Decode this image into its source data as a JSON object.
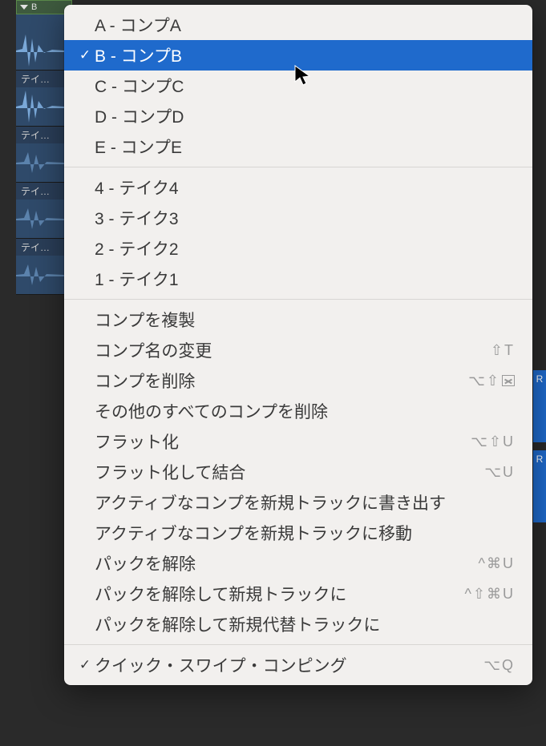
{
  "tracks": {
    "header_label": "B",
    "lanes": [
      {
        "label": ""
      },
      {
        "label": "テイ…"
      },
      {
        "label": "テイ…"
      },
      {
        "label": "テイ…"
      },
      {
        "label": "テイ…"
      }
    ]
  },
  "region_hint_letter": "R",
  "menu": {
    "comps": [
      {
        "key": "A",
        "label": "A - コンプA",
        "checked": false,
        "selected": false
      },
      {
        "key": "B",
        "label": "B - コンプB",
        "checked": true,
        "selected": true
      },
      {
        "key": "C",
        "label": "C - コンプC",
        "checked": false,
        "selected": false
      },
      {
        "key": "D",
        "label": "D - コンプD",
        "checked": false,
        "selected": false
      },
      {
        "key": "E",
        "label": "E - コンプE",
        "checked": false,
        "selected": false
      }
    ],
    "takes": [
      {
        "label": "4 - テイク4"
      },
      {
        "label": "3 - テイク3"
      },
      {
        "label": "2 - テイク2"
      },
      {
        "label": "1 - テイク1"
      }
    ],
    "actions": [
      {
        "id": "duplicate-comp",
        "label": "コンプを複製",
        "shortcut": ""
      },
      {
        "id": "rename-comp",
        "label": "コンプ名の変更",
        "shortcut": "⇧T"
      },
      {
        "id": "delete-comp",
        "label": "コンプを削除",
        "shortcut": "⌥⇧",
        "shortcut_has_delbox": true
      },
      {
        "id": "delete-other-comps",
        "label": "その他のすべてのコンプを削除",
        "shortcut": ""
      },
      {
        "id": "flatten",
        "label": "フラット化",
        "shortcut": "⌥⇧U"
      },
      {
        "id": "flatten-merge",
        "label": "フラット化して結合",
        "shortcut": "⌥U"
      },
      {
        "id": "export-active-track",
        "label": "アクティブなコンプを新規トラックに書き出す",
        "shortcut": ""
      },
      {
        "id": "move-active-track",
        "label": "アクティブなコンプを新規トラックに移動",
        "shortcut": ""
      },
      {
        "id": "unpack",
        "label": "パックを解除",
        "shortcut": "^⌘U"
      },
      {
        "id": "unpack-new-tracks",
        "label": "パックを解除して新規トラックに",
        "shortcut": "^⇧⌘U"
      },
      {
        "id": "unpack-alt-tracks",
        "label": "パックを解除して新規代替トラックに",
        "shortcut": ""
      }
    ],
    "footer": {
      "label": "クイック・スワイプ・コンピング",
      "checked": true,
      "shortcut": "⌥Q"
    }
  }
}
